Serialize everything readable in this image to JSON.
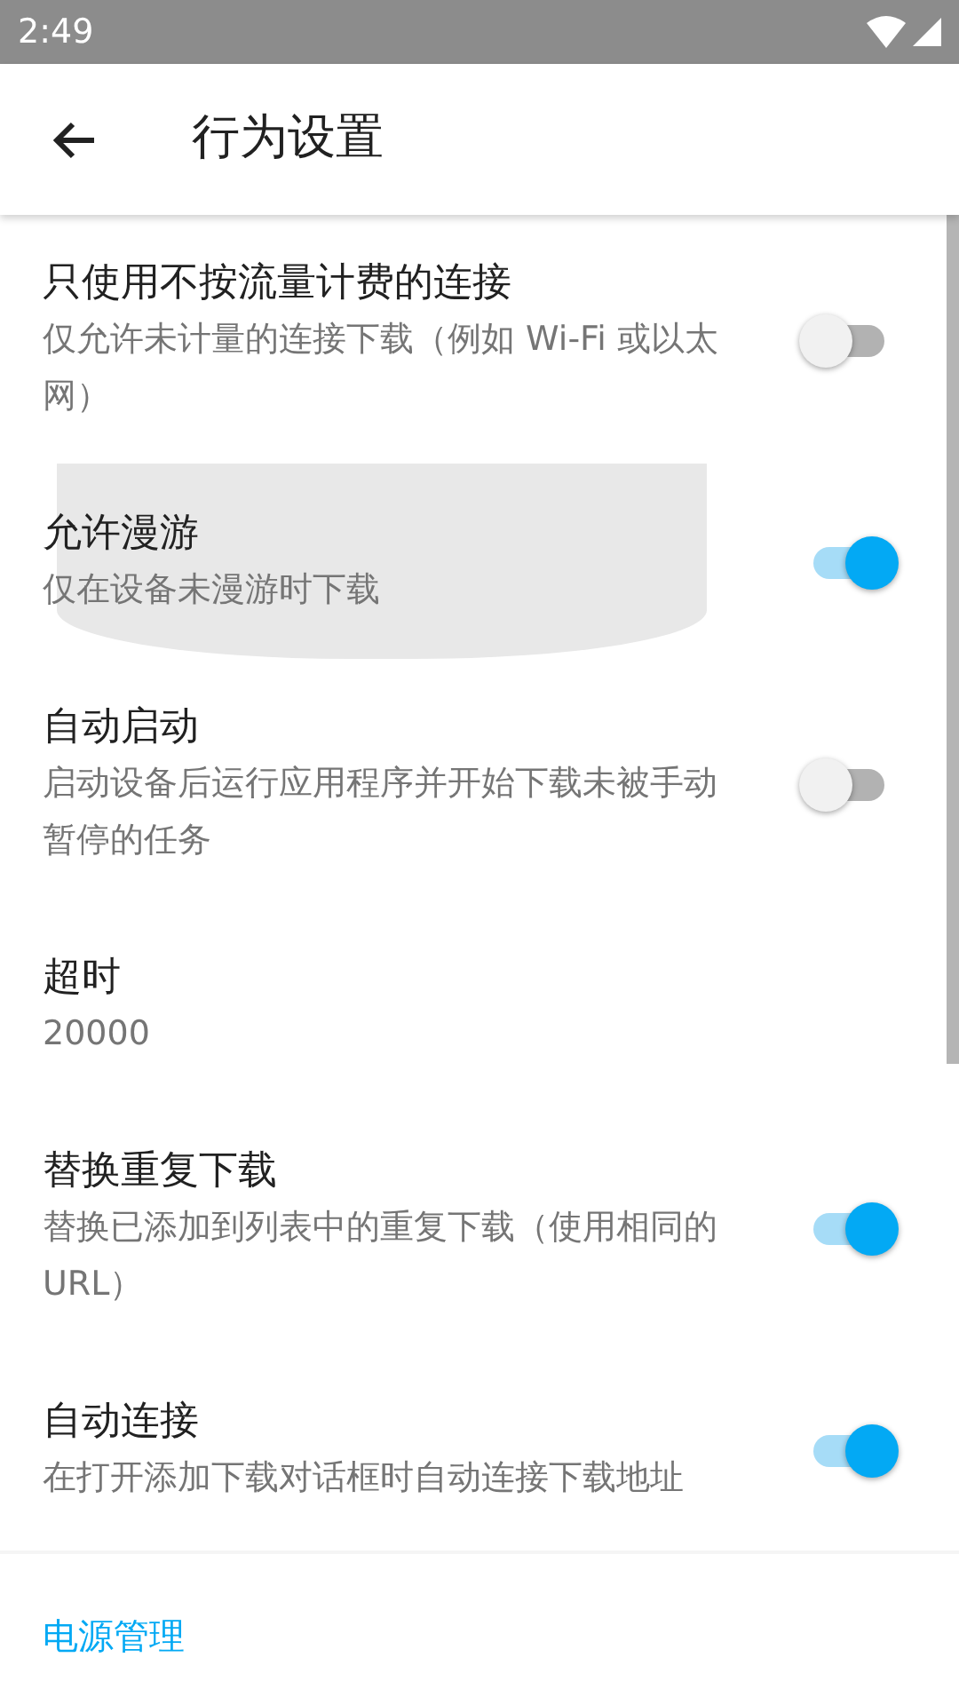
{
  "status_bar": {
    "time": "2:49"
  },
  "toolbar": {
    "title": "行为设置"
  },
  "settings": [
    {
      "title": "只使用不按流量计费的连接",
      "summary": "仅允许未计量的连接下载（例如 Wi-Fi 或以太网）",
      "kind": "switch",
      "on": false,
      "pressed": false
    },
    {
      "title": "允许漫游",
      "summary": "仅在设备未漫游时下载",
      "kind": "switch",
      "on": true,
      "pressed": true
    },
    {
      "title": "自动启动",
      "summary": "启动设备后运行应用程序并开始下载未被手动暂停的任务",
      "kind": "switch",
      "on": false,
      "pressed": false
    },
    {
      "title": "超时",
      "summary": "20000",
      "kind": "value",
      "pressed": false
    },
    {
      "title": "替换重复下载",
      "summary": "替换已添加到列表中的重复下载（使用相同的 URL）",
      "kind": "switch",
      "on": true,
      "pressed": false
    },
    {
      "title": "自动连接",
      "summary": "在打开添加下载对话框时自动连接下载地址",
      "kind": "switch",
      "on": true,
      "pressed": false
    }
  ],
  "category": {
    "title": "电源管理"
  }
}
